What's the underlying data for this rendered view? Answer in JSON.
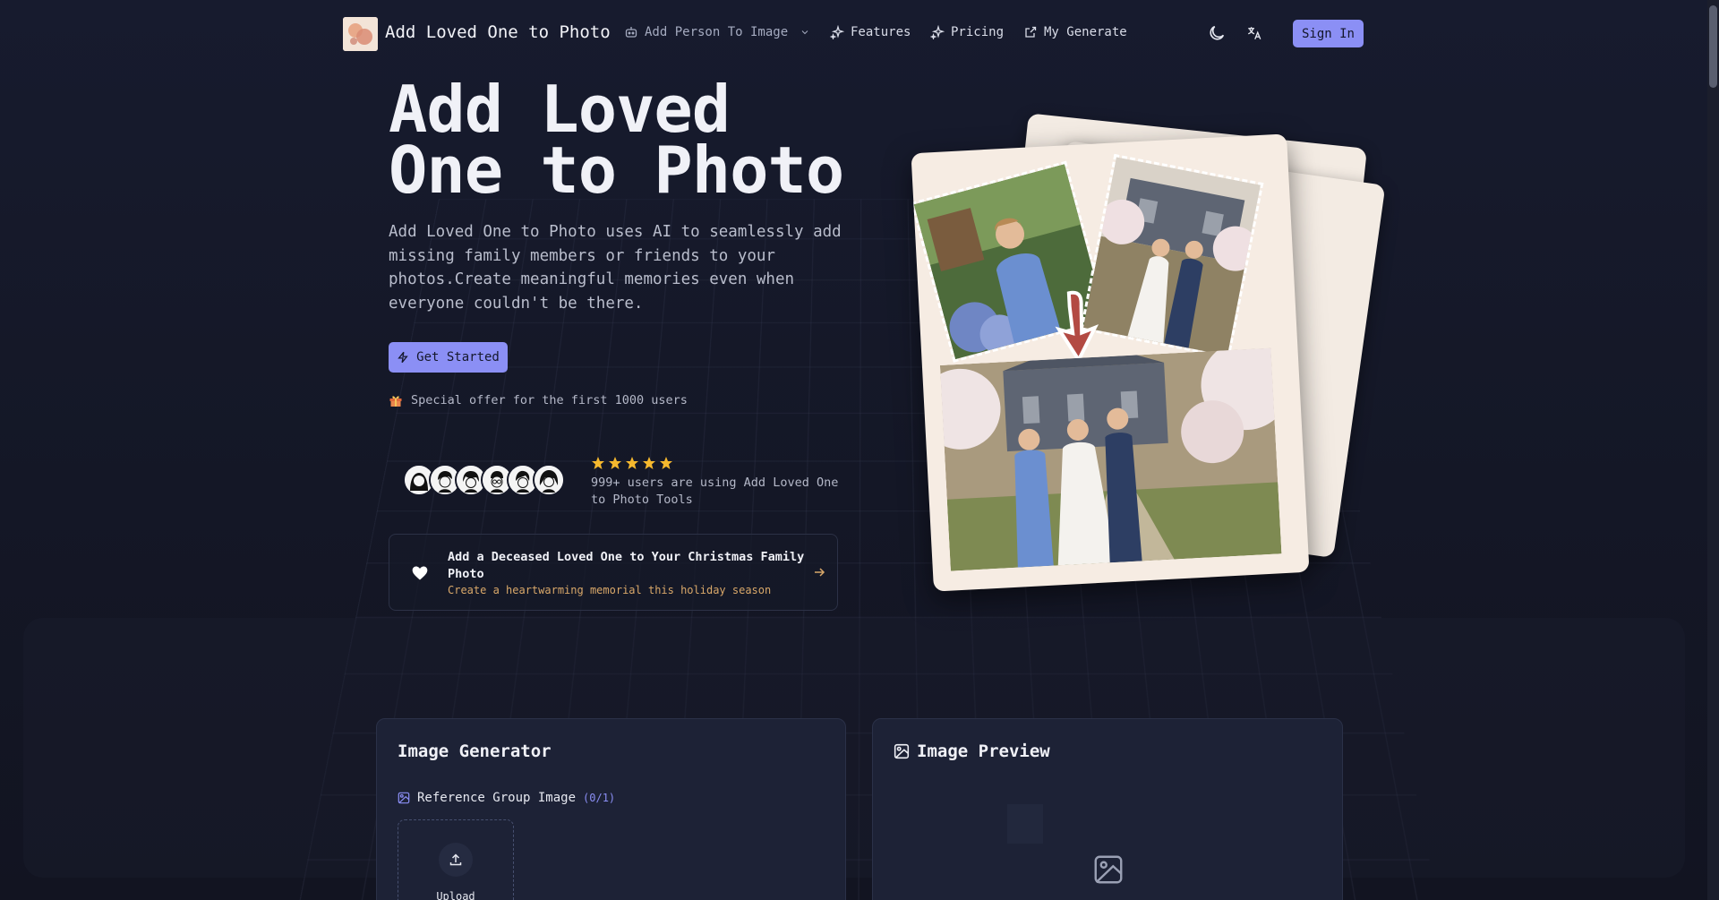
{
  "header": {
    "brand": "Add Loved One to Photo",
    "nav": [
      {
        "label": "Add Person To Image",
        "icon": "robot-icon"
      },
      {
        "label": "Features",
        "icon": "sparkles-icon"
      },
      {
        "label": "Pricing",
        "icon": "sparkles-icon"
      },
      {
        "label": "My Generate",
        "icon": "external-link-icon"
      }
    ],
    "sign_in": "Sign In"
  },
  "hero": {
    "title_line1": "Add Loved",
    "title_line2": "One to Photo",
    "description": "Add Loved One to Photo uses AI to seamlessly add missing family members or friends to your photos.Create meaningful memories even when everyone couldn't be there.",
    "cta": "Get Started",
    "offer": "Special offer for the first 1000 users",
    "rating_stars": 5,
    "users_text": "999+ users are using Add Loved One to Photo Tools"
  },
  "promo": {
    "title": "Add a Deceased Loved One to Your Christmas Family Photo",
    "subtitle": "Create a heartwarming memorial this holiday season"
  },
  "generator": {
    "title": "Image Generator",
    "reference_label": "Reference Group Image",
    "reference_count": "(0/1)",
    "upload_label": "Upload"
  },
  "preview": {
    "title": "Image Preview"
  },
  "colors": {
    "accent": "#8b8ff5",
    "background": "#151828",
    "star": "#f5b82e",
    "promo_sub": "#d9a86a"
  }
}
